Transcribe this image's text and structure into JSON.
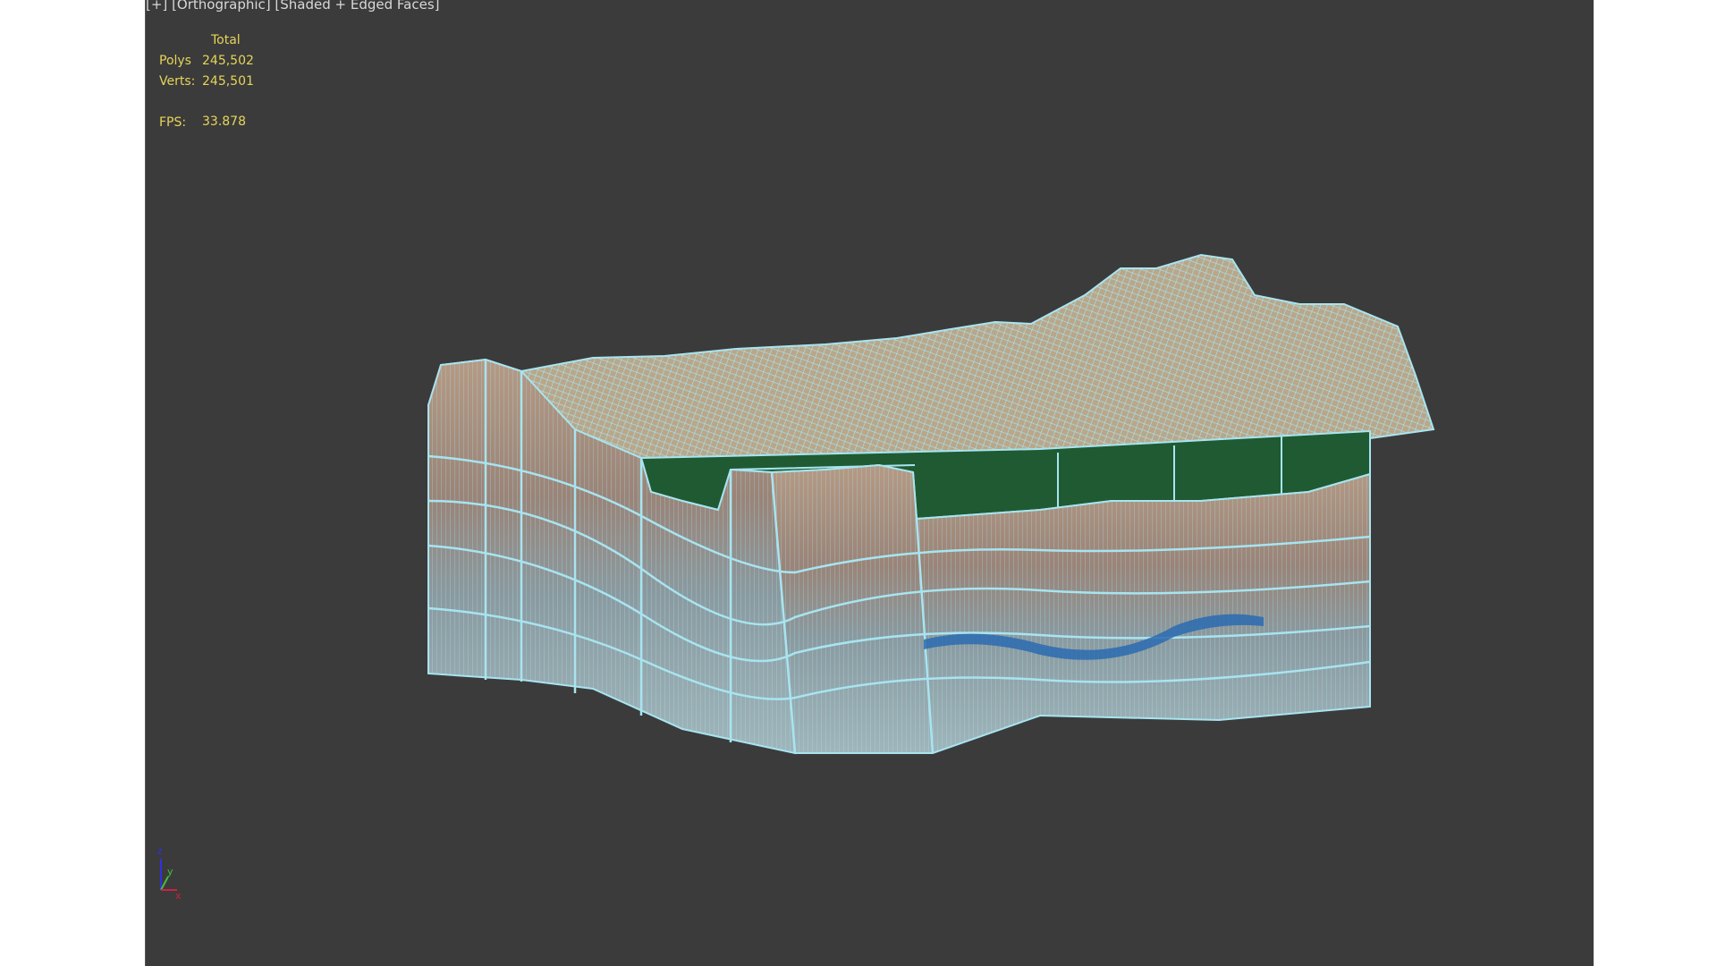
{
  "viewport": {
    "label_plus": "[+]",
    "label_view": "[Orthographic]",
    "label_shading": "[Shaded + Edged Faces]"
  },
  "stats": {
    "header": "Total",
    "polys_label": "Polys",
    "polys_value": "245,502",
    "verts_label": "Verts:",
    "verts_value": "245,501",
    "fps_label": "FPS:",
    "fps_value": "33.878"
  },
  "axis_gizmo": {
    "z": "z",
    "y": "y",
    "x": "x"
  },
  "colors": {
    "background": "#3b3b3b",
    "wire": "#a8e4f0",
    "green_top": "#1f5a32",
    "stats": "#e6d45a"
  }
}
